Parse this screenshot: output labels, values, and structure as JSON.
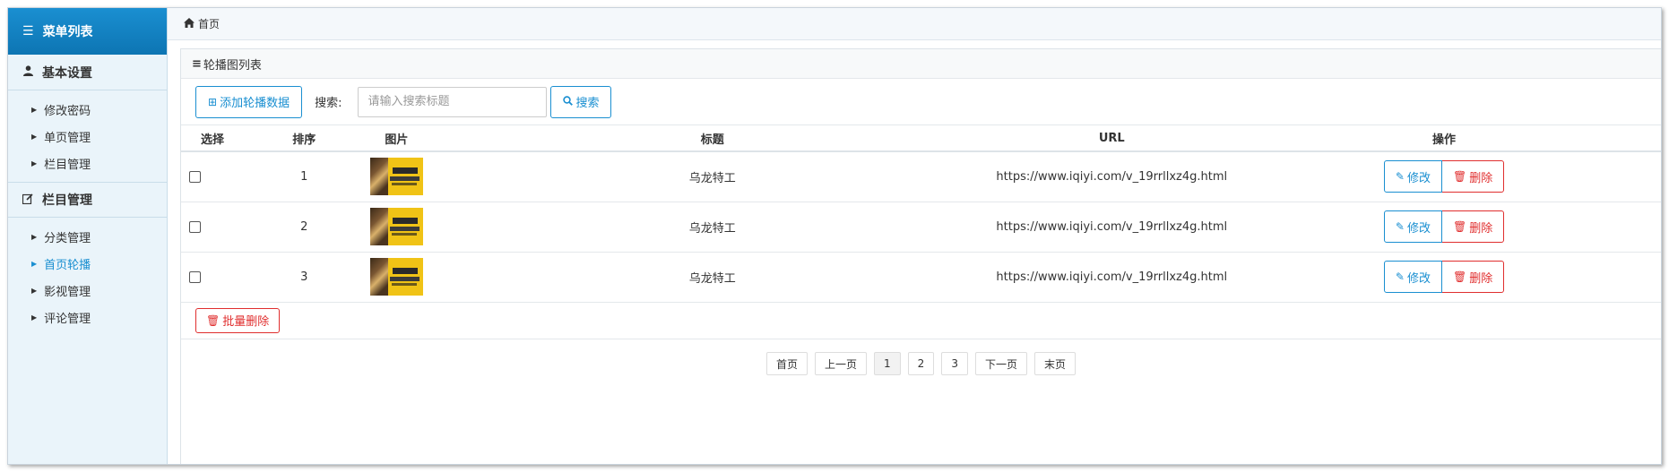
{
  "sidebar": {
    "header": "菜单列表",
    "sections": [
      {
        "title": "基本设置",
        "icon": "user-icon",
        "items": [
          {
            "label": "修改密码"
          },
          {
            "label": "单页管理"
          },
          {
            "label": "栏目管理"
          }
        ]
      },
      {
        "title": "栏目管理",
        "icon": "edit-icon",
        "items": [
          {
            "label": "分类管理"
          },
          {
            "label": "首页轮播",
            "active": true
          },
          {
            "label": "影视管理"
          },
          {
            "label": "评论管理"
          }
        ]
      }
    ]
  },
  "breadcrumb": {
    "home": "首页"
  },
  "panel": {
    "title": "轮播图列表"
  },
  "toolbar": {
    "add_label": "添加轮播数据",
    "search_label": "搜索:",
    "search_placeholder": "请输入搜索标题",
    "search_value": "",
    "search_button": "搜索"
  },
  "table": {
    "headers": {
      "select": "选择",
      "order": "排序",
      "image": "图片",
      "title": "标题",
      "url": "URL",
      "ops": "操作"
    },
    "rows": [
      {
        "order": "1",
        "title": "乌龙特工",
        "url": "https://www.iqiyi.com/v_19rrllxz4g.html"
      },
      {
        "order": "2",
        "title": "乌龙特工",
        "url": "https://www.iqiyi.com/v_19rrllxz4g.html"
      },
      {
        "order": "3",
        "title": "乌龙特工",
        "url": "https://www.iqiyi.com/v_19rrllxz4g.html"
      }
    ],
    "edit_label": "修改",
    "delete_label": "删除"
  },
  "batch_delete_label": "批量删除",
  "pagination": {
    "first": "首页",
    "prev": "上一页",
    "pages": [
      "1",
      "2",
      "3"
    ],
    "current": "1",
    "next": "下一页",
    "last": "末页"
  },
  "colors": {
    "accent": "#1a8fd1",
    "danger": "#e02e2e",
    "sidebar_bg": "#eaf4fa"
  }
}
